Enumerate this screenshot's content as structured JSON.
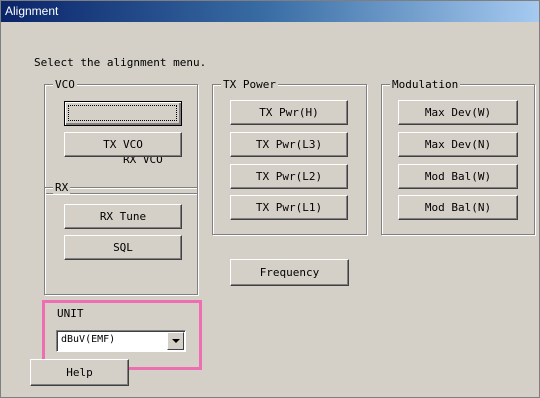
{
  "window": {
    "title": "Alignment"
  },
  "prompt": "Select the alignment menu.",
  "groups": {
    "vco": {
      "label": "VCO",
      "buttons": {
        "rx_vco": "RX VCO",
        "tx_vco": "TX VCO"
      }
    },
    "rx": {
      "label": "RX",
      "buttons": {
        "rx_tune": "RX Tune",
        "sql": "SQL"
      }
    },
    "tx_power": {
      "label": "TX Power",
      "buttons": {
        "h": "TX Pwr(H)",
        "l3": "TX Pwr(L3)",
        "l2": "TX Pwr(L2)",
        "l1": "TX Pwr(L1)"
      }
    },
    "modulation": {
      "label": "Modulation",
      "buttons": {
        "max_dev_w": "Max Dev(W)",
        "max_dev_n": "Max Dev(N)",
        "mod_bal_w": "Mod Bal(W)",
        "mod_bal_n": "Mod Bal(N)"
      }
    }
  },
  "frequency_button": "Frequency",
  "unit": {
    "label": "UNIT",
    "selected": "dBuV(EMF)"
  },
  "help_button": "Help",
  "colors": {
    "highlight": "#ee6fb1",
    "face": "#d4d0c8"
  }
}
